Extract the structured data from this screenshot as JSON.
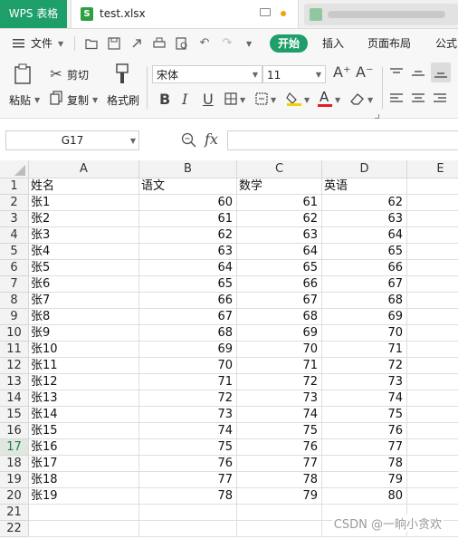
{
  "tabs": {
    "app": "WPS 表格",
    "file": "test.xlsx",
    "file_icon_letter": "S"
  },
  "menu": {
    "file": "文件",
    "items": [
      "开始",
      "插入",
      "页面布局",
      "公式"
    ]
  },
  "ribbon": {
    "paste": "粘贴",
    "cut": "剪切",
    "copy": "复制",
    "format_painter": "格式刷",
    "font_name": "宋体",
    "font_size": "11"
  },
  "formula_bar": {
    "cell_ref": "G17",
    "fx": "fx",
    "value": ""
  },
  "sheet": {
    "columns": [
      "A",
      "B",
      "C",
      "D",
      "E"
    ],
    "rows": [
      {
        "n": "1",
        "a": "姓名",
        "b": "语文",
        "c": "数学",
        "d": "英语"
      },
      {
        "n": "2",
        "a": "张1",
        "b": "60",
        "c": "61",
        "d": "62"
      },
      {
        "n": "3",
        "a": "张2",
        "b": "61",
        "c": "62",
        "d": "63"
      },
      {
        "n": "4",
        "a": "张3",
        "b": "62",
        "c": "63",
        "d": "64"
      },
      {
        "n": "5",
        "a": "张4",
        "b": "63",
        "c": "64",
        "d": "65"
      },
      {
        "n": "6",
        "a": "张5",
        "b": "64",
        "c": "65",
        "d": "66"
      },
      {
        "n": "7",
        "a": "张6",
        "b": "65",
        "c": "66",
        "d": "67"
      },
      {
        "n": "8",
        "a": "张7",
        "b": "66",
        "c": "67",
        "d": "68"
      },
      {
        "n": "9",
        "a": "张8",
        "b": "67",
        "c": "68",
        "d": "69"
      },
      {
        "n": "10",
        "a": "张9",
        "b": "68",
        "c": "69",
        "d": "70"
      },
      {
        "n": "11",
        "a": "张10",
        "b": "69",
        "c": "70",
        "d": "71"
      },
      {
        "n": "12",
        "a": "张11",
        "b": "70",
        "c": "71",
        "d": "72"
      },
      {
        "n": "13",
        "a": "张12",
        "b": "71",
        "c": "72",
        "d": "73"
      },
      {
        "n": "14",
        "a": "张13",
        "b": "72",
        "c": "73",
        "d": "74"
      },
      {
        "n": "15",
        "a": "张14",
        "b": "73",
        "c": "74",
        "d": "75"
      },
      {
        "n": "16",
        "a": "张15",
        "b": "74",
        "c": "75",
        "d": "76"
      },
      {
        "n": "17",
        "a": "张16",
        "b": "75",
        "c": "76",
        "d": "77"
      },
      {
        "n": "18",
        "a": "张17",
        "b": "76",
        "c": "77",
        "d": "78"
      },
      {
        "n": "19",
        "a": "张18",
        "b": "77",
        "c": "78",
        "d": "79"
      },
      {
        "n": "20",
        "a": "张19",
        "b": "78",
        "c": "79",
        "d": "80"
      },
      {
        "n": "21",
        "a": "",
        "b": "",
        "c": "",
        "d": ""
      },
      {
        "n": "22",
        "a": "",
        "b": "",
        "c": "",
        "d": ""
      }
    ],
    "selected_row": "17"
  },
  "watermark": "CSDN @一晌小贪欢",
  "colors": {
    "brand_green": "#1e9f6a",
    "accent_orange": "#f0a30a"
  }
}
